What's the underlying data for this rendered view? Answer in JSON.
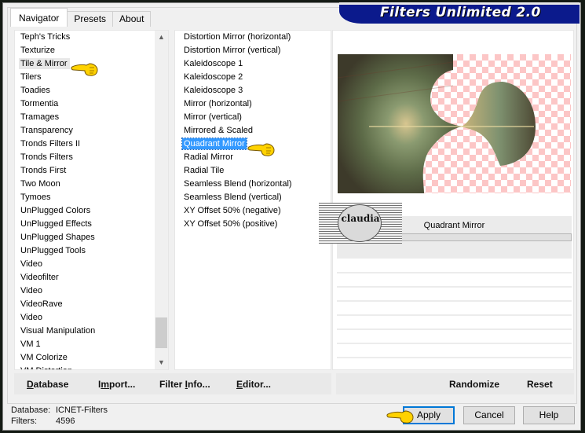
{
  "window": {
    "banner_title": "Filters Unlimited 2.0"
  },
  "tabs": [
    {
      "label": "Navigator",
      "active": true
    },
    {
      "label": "Presets",
      "active": false
    },
    {
      "label": "About",
      "active": false
    }
  ],
  "categories": {
    "items": [
      "Teph's Tricks",
      "Texturize",
      "Tile & Mirror",
      "Tilers",
      "Toadies",
      "Tormentia",
      "Tramages",
      "Transparency",
      "Tronds Filters II",
      "Tronds Filters",
      "Tronds First",
      "Two Moon",
      "Tymoes",
      "UnPlugged Colors",
      "UnPlugged Effects",
      "UnPlugged Shapes",
      "UnPlugged Tools",
      "Video",
      "Videofilter",
      "Video",
      "VideoRave",
      "Video",
      "Visual Manipulation",
      "VM 1",
      "VM Colorize",
      "VM Distortion"
    ],
    "selected": "Tile & Mirror"
  },
  "filters": {
    "items": [
      "Distortion Mirror (horizontal)",
      "Distortion Mirror (vertical)",
      "Kaleidoscope 1",
      "Kaleidoscope 2",
      "Kaleidoscope 3",
      "Mirror (horizontal)",
      "Mirror (vertical)",
      "Mirrored & Scaled",
      "Quadrant Mirror",
      "Radial Mirror",
      "Radial Tile",
      "Seamless Blend (horizontal)",
      "Seamless Blend (vertical)",
      "XY Offset 50% (negative)",
      "XY Offset 50% (positive)"
    ],
    "selected": "Quadrant Mirror"
  },
  "preview": {
    "filter_name": "Quadrant Mirror",
    "watermark": "claudia"
  },
  "left_buttons": {
    "database": {
      "pre": "",
      "u": "D",
      "post": "atabase"
    },
    "import": {
      "pre": "I",
      "u": "m",
      "post": "port..."
    },
    "filter_info": {
      "pre": "Filter ",
      "u": "I",
      "post": "nfo..."
    },
    "editor": {
      "pre": "",
      "u": "E",
      "post": "ditor..."
    }
  },
  "right_buttons": {
    "randomize": "Randomize",
    "reset": "Reset"
  },
  "status": {
    "database_label": "Database:",
    "database_value": "ICNET-Filters",
    "filters_label": "Filters:",
    "filters_value": "4596"
  },
  "dialog_buttons": {
    "apply": "Apply",
    "cancel": "Cancel",
    "help": "Help"
  },
  "colors": {
    "banner": "#0b1a8c",
    "selection": "#3399ff",
    "default_button_border": "#0078d7",
    "checker": "#fcc6c6"
  }
}
